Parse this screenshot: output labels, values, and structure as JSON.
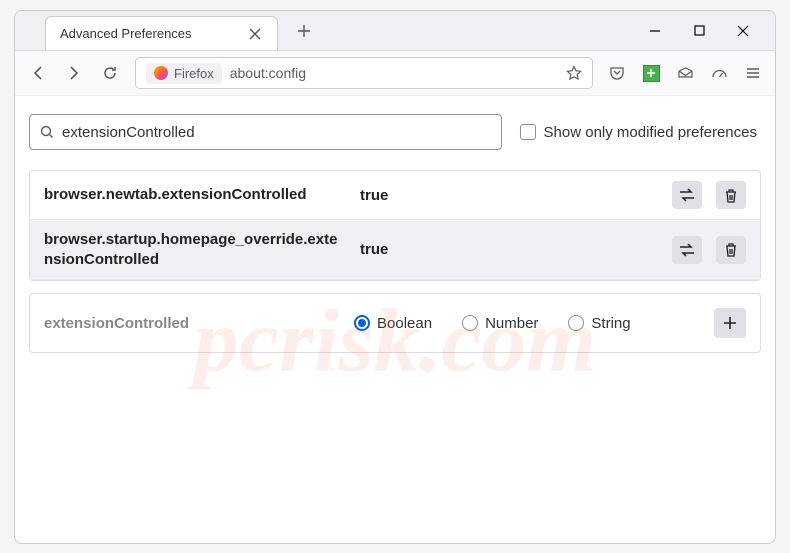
{
  "tab": {
    "title": "Advanced Preferences"
  },
  "urlbar": {
    "badge": "Firefox",
    "url": "about:config"
  },
  "search": {
    "value": "extensionControlled",
    "checkbox_label": "Show only modified preferences"
  },
  "prefs": [
    {
      "name": "browser.newtab.extensionControlled",
      "value": "true"
    },
    {
      "name": "browser.startup.homepage_override.extensionControlled",
      "value": "true"
    }
  ],
  "new_pref": {
    "name": "extensionControlled",
    "types": [
      "Boolean",
      "Number",
      "String"
    ],
    "selected": "Boolean"
  },
  "watermark": "pcrisk.com"
}
